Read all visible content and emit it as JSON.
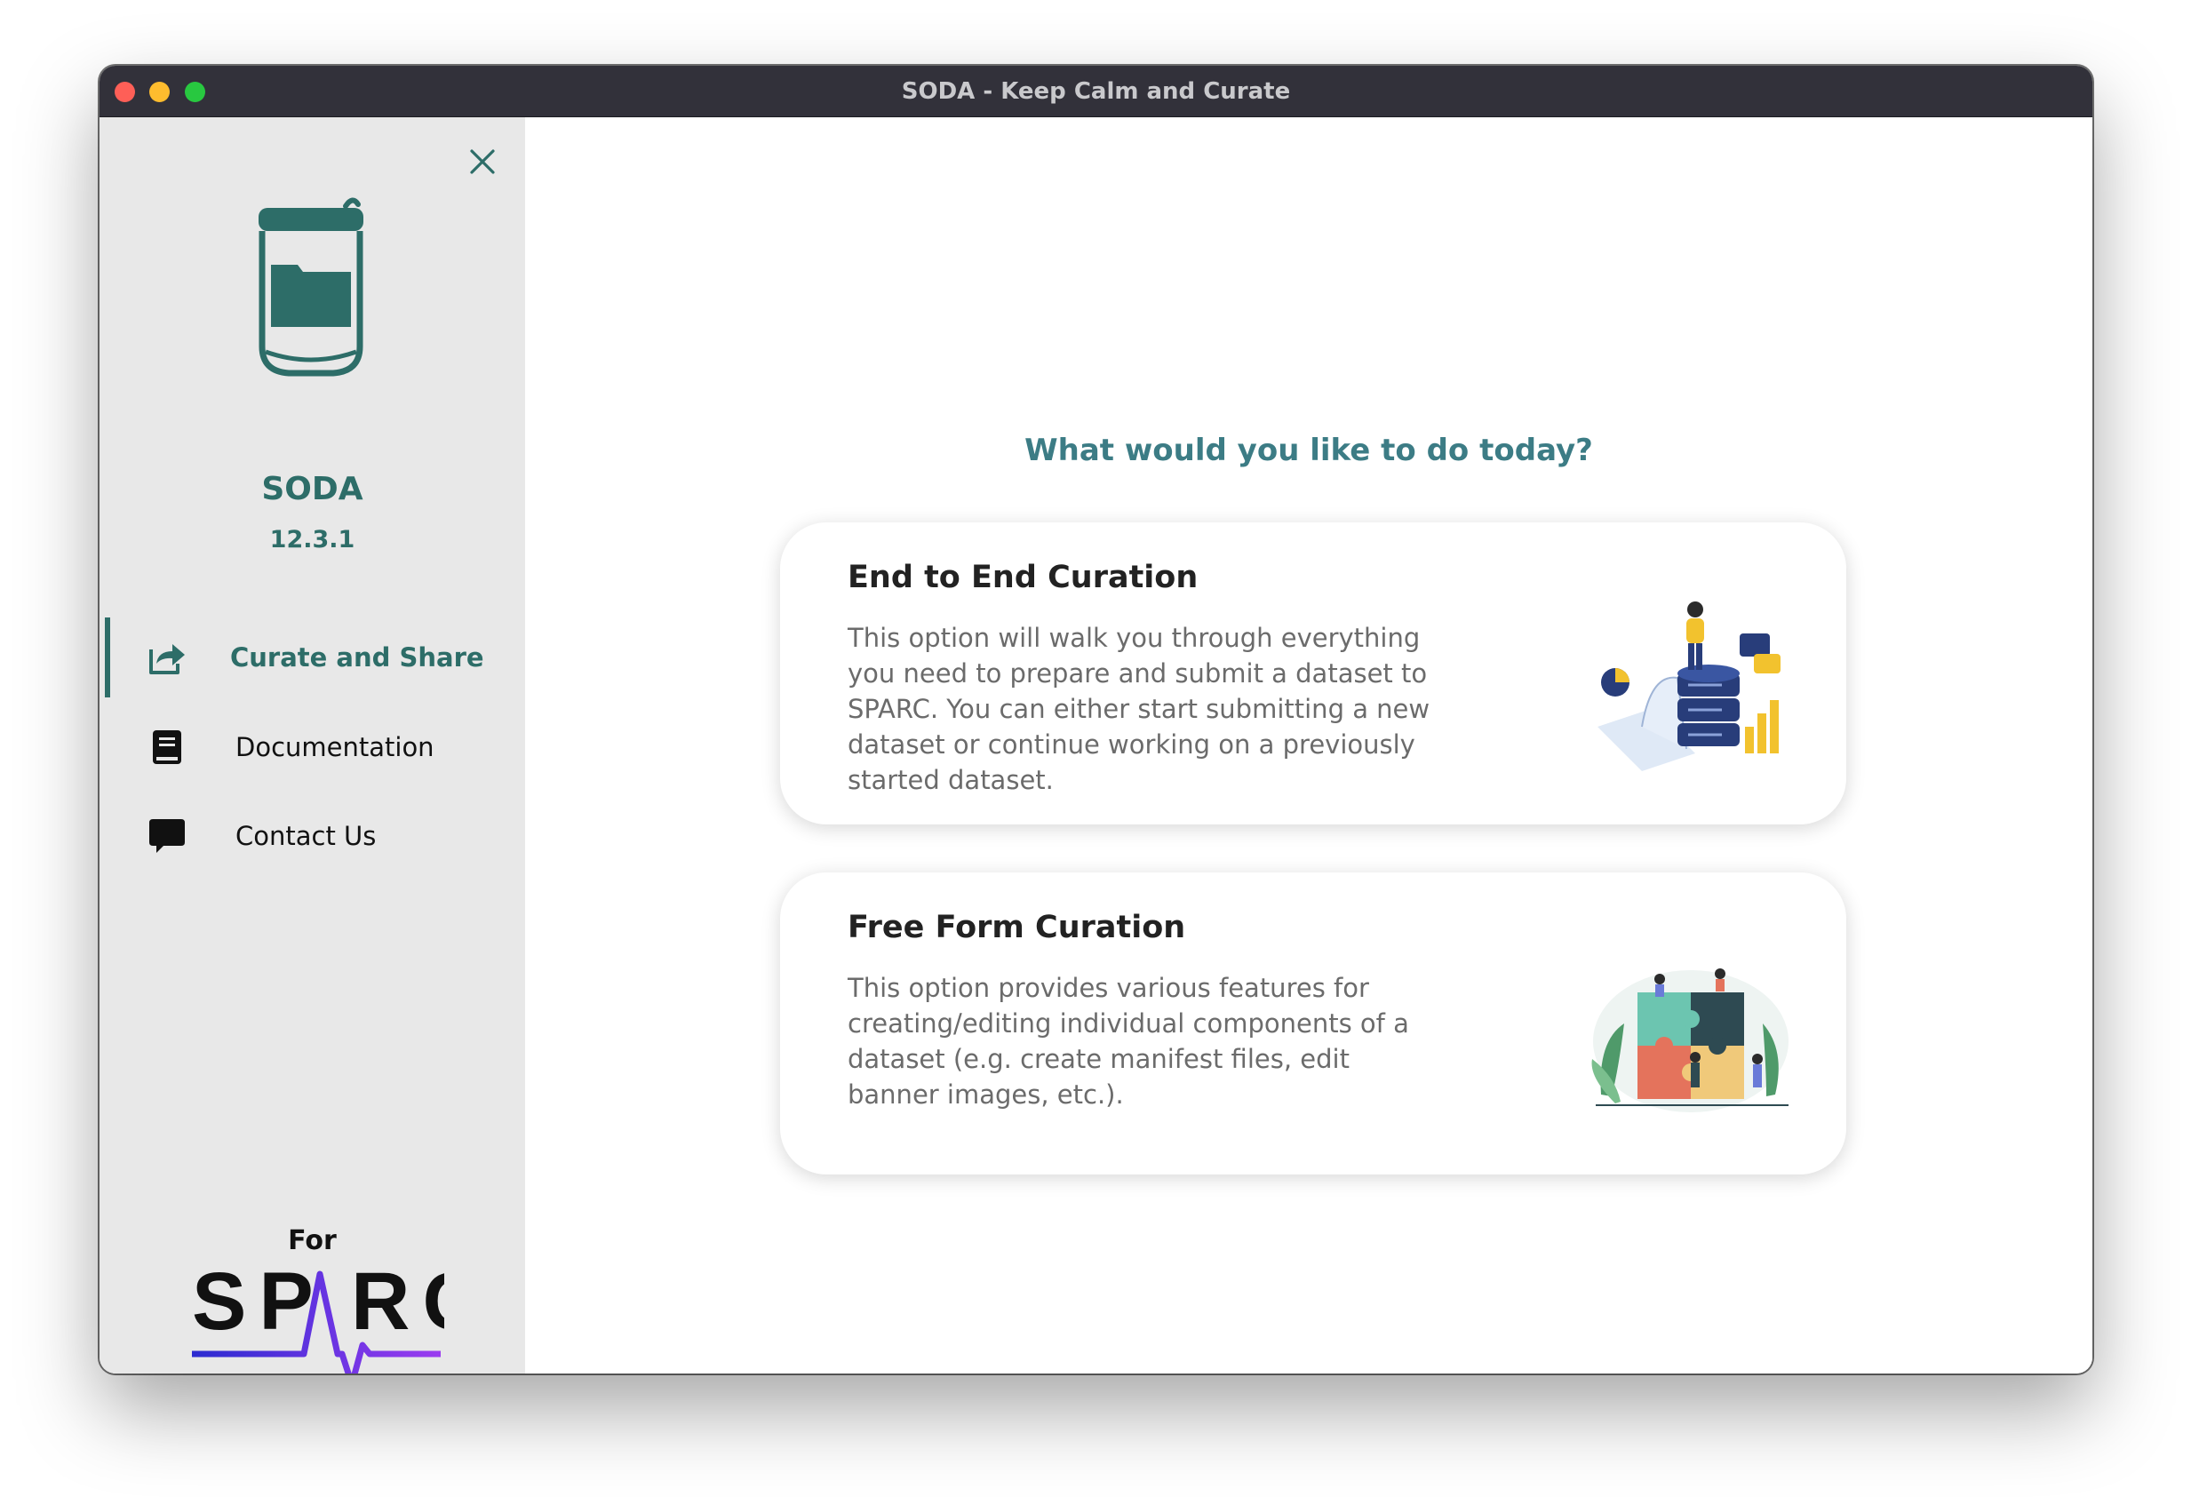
{
  "window": {
    "title": "SODA - Keep Calm and Curate"
  },
  "sidebar": {
    "app_name": "SODA",
    "version": "12.3.1",
    "nav": [
      {
        "label": "Curate and Share",
        "icon": "share-icon",
        "active": true
      },
      {
        "label": "Documentation",
        "icon": "book-icon",
        "active": false
      },
      {
        "label": "Contact Us",
        "icon": "chat-icon",
        "active": false
      }
    ],
    "footer": {
      "for_label": "For",
      "brand": "SPARC"
    }
  },
  "main": {
    "heading": "What would you like to do today?",
    "cards": [
      {
        "title": "End to End Curation",
        "description": "This option will walk you through everything you need to prepare and submit a dataset to SPARC. You can either start submitting a new dataset or continue working on a previously started dataset.",
        "illustration": "server-illustration"
      },
      {
        "title": "Free Form Curation",
        "description": "This option provides various features for creating/editing individual components of a dataset (e.g. create manifest files, edit banner images, etc.).",
        "illustration": "puzzle-illustration"
      }
    ]
  },
  "colors": {
    "accent": "#2d6d68",
    "heading": "#3c7c85",
    "sidebar_bg": "#e8e8e8",
    "titlebar_bg": "#32313a"
  }
}
